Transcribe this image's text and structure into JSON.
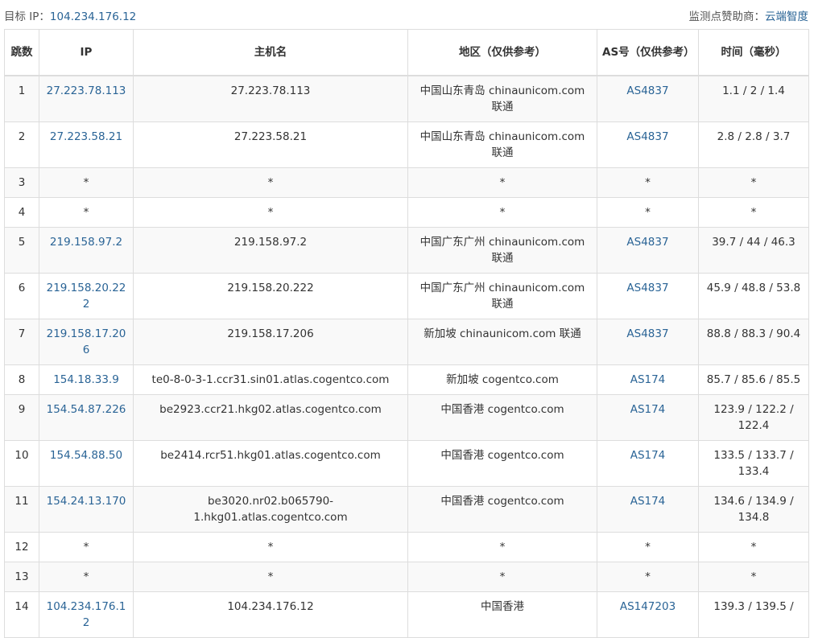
{
  "header": {
    "target_label": "目标 IP：",
    "target_ip": "104.234.176.12",
    "sponsor_label": "监测点赞助商：",
    "sponsor_name": "云端智度"
  },
  "table": {
    "columns": [
      "跳数",
      "IP",
      "主机名",
      "地区（仅供参考）",
      "AS号（仅供参考）",
      "时间（毫秒）"
    ],
    "rows": [
      {
        "hop": "1",
        "ip": "27.223.78.113",
        "host": "27.223.78.113",
        "region": "中国山东青岛 chinaunicom.com 联通",
        "as": "AS4837",
        "time": "1.1 / 2 / 1.4"
      },
      {
        "hop": "2",
        "ip": "27.223.58.21",
        "host": "27.223.58.21",
        "region": "中国山东青岛 chinaunicom.com 联通",
        "as": "AS4837",
        "time": "2.8 / 2.8 / 3.7"
      },
      {
        "hop": "3",
        "ip": "*",
        "host": "*",
        "region": "*",
        "as": "*",
        "time": "*"
      },
      {
        "hop": "4",
        "ip": "*",
        "host": "*",
        "region": "*",
        "as": "*",
        "time": "*"
      },
      {
        "hop": "5",
        "ip": "219.158.97.2",
        "host": "219.158.97.2",
        "region": "中国广东广州 chinaunicom.com 联通",
        "as": "AS4837",
        "time": "39.7 / 44 / 46.3"
      },
      {
        "hop": "6",
        "ip": "219.158.20.222",
        "host": "219.158.20.222",
        "region": "中国广东广州 chinaunicom.com 联通",
        "as": "AS4837",
        "time": "45.9 / 48.8 / 53.8"
      },
      {
        "hop": "7",
        "ip": "219.158.17.206",
        "host": "219.158.17.206",
        "region": "新加坡 chinaunicom.com 联通",
        "as": "AS4837",
        "time": "88.8 / 88.3 / 90.4"
      },
      {
        "hop": "8",
        "ip": "154.18.33.9",
        "host": "te0-8-0-3-1.ccr31.sin01.atlas.cogentco.com",
        "region": "新加坡 cogentco.com",
        "as": "AS174",
        "time": "85.7 / 85.6 / 85.5"
      },
      {
        "hop": "9",
        "ip": "154.54.87.226",
        "host": "be2923.ccr21.hkg02.atlas.cogentco.com",
        "region": "中国香港 cogentco.com",
        "as": "AS174",
        "time": "123.9 / 122.2 / 122.4"
      },
      {
        "hop": "10",
        "ip": "154.54.88.50",
        "host": "be2414.rcr51.hkg01.atlas.cogentco.com",
        "region": "中国香港 cogentco.com",
        "as": "AS174",
        "time": "133.5 / 133.7 / 133.4"
      },
      {
        "hop": "11",
        "ip": "154.24.13.170",
        "host": "be3020.nr02.b065790-1.hkg01.atlas.cogentco.com",
        "region": "中国香港 cogentco.com",
        "as": "AS174",
        "time": "134.6 / 134.9 / 134.8"
      },
      {
        "hop": "12",
        "ip": "*",
        "host": "*",
        "region": "*",
        "as": "*",
        "time": "*"
      },
      {
        "hop": "13",
        "ip": "*",
        "host": "*",
        "region": "*",
        "as": "*",
        "time": "*"
      },
      {
        "hop": "14",
        "ip": "104.234.176.12",
        "host": "104.234.176.12",
        "region": "中国香港 ",
        "as": "AS147203",
        "time": "139.3 / 139.5 / "
      }
    ]
  },
  "colors": {
    "link": "#2a6496",
    "border": "#dddddd",
    "stripe": "#f9f9f9"
  }
}
